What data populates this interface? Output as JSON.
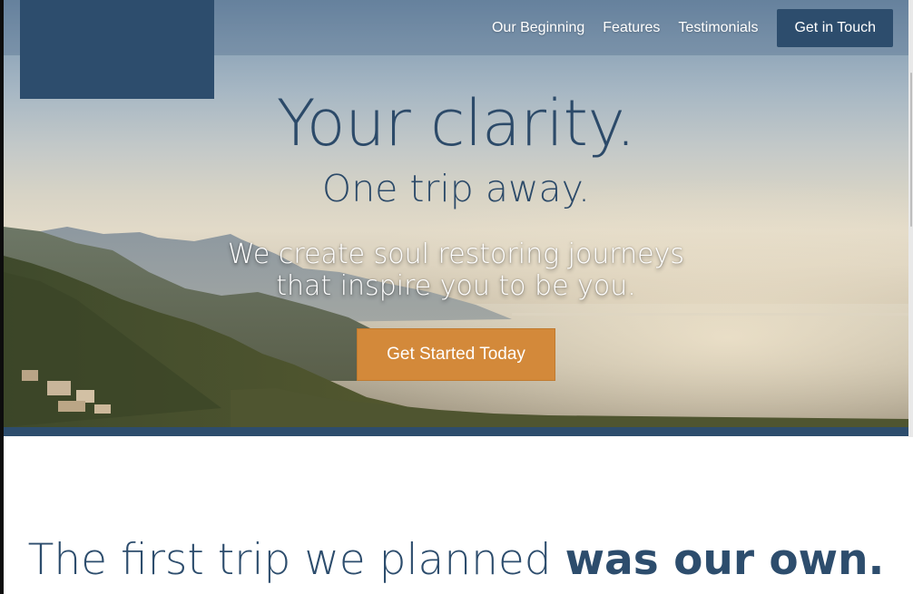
{
  "nav": {
    "links": [
      {
        "label": "Our Beginning"
      },
      {
        "label": "Features"
      },
      {
        "label": "Testimonials"
      }
    ],
    "cta_label": "Get in Touch"
  },
  "hero": {
    "headline": "Your clarity.",
    "subheadline": "One trip away.",
    "tagline_line1": "We create soul restoring journeys",
    "tagline_line2": "that inspire you to be you.",
    "cta_label": "Get Started Today"
  },
  "section": {
    "title_light": "The first trip we planned ",
    "title_bold": "was our own."
  },
  "colors": {
    "brand_navy": "#2d4d6d",
    "accent_orange": "#d3893a"
  }
}
